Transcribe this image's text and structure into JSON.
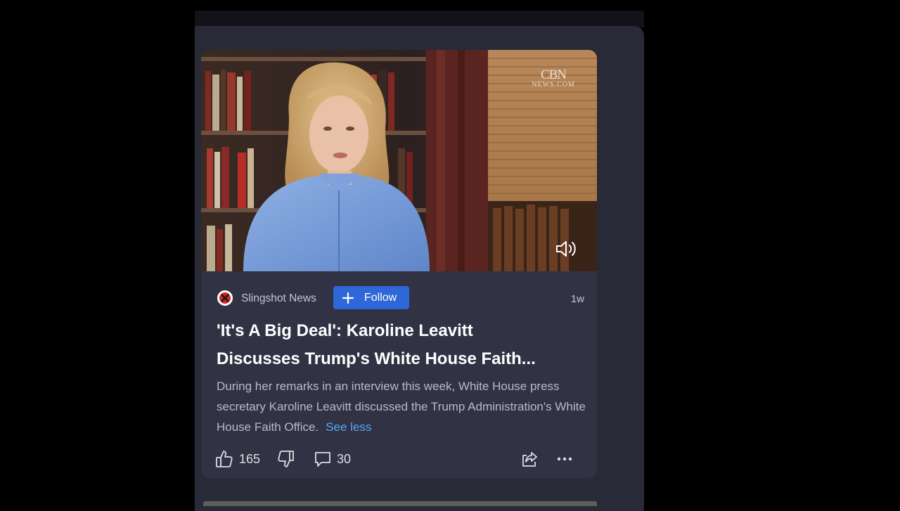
{
  "video": {
    "watermark_top": "CBN",
    "watermark_bottom": "NEWS.COM",
    "mute_icon": "volume-icon"
  },
  "post": {
    "source_name": "Slingshot News",
    "follow_label": "Follow",
    "age": "1w",
    "headline_line1": "'It's A Big Deal': Karoline Leavitt",
    "headline_line2": "Discusses Trump's White House Faith...",
    "summary": "During her remarks in an interview this week, White House press secretary Karoline Leavitt discussed the Trump Administration's White House Faith Office.",
    "see_less": "See less"
  },
  "actions": {
    "likes": "165",
    "comments": "30",
    "icons": [
      "thumbs-up-icon",
      "thumbs-down-icon",
      "comment-icon",
      "share-icon",
      "more-icon"
    ]
  },
  "colors": {
    "panel": "#282a38",
    "card": "#313344",
    "follow": "#2f67d8",
    "link": "#58a6f2"
  }
}
